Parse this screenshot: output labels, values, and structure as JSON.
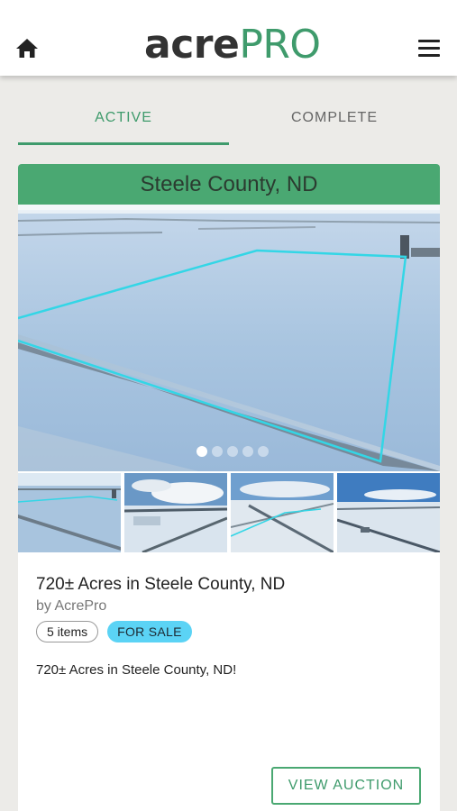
{
  "header": {
    "home_icon": "home-icon",
    "logo_part1": "acre",
    "logo_part2": "PRO",
    "menu_icon": "hamburger-menu-icon"
  },
  "tabs": [
    {
      "label": "ACTIVE",
      "selected": true
    },
    {
      "label": "COMPLETE",
      "selected": false
    }
  ],
  "listing": {
    "location_header": "Steele County, ND",
    "title": "720± Acres in Steele County, ND",
    "by": "by AcrePro",
    "items_badge": "5 items",
    "status_badge": "FOR SALE",
    "description": "720± Acres in Steele County, ND!",
    "button_label": "VIEW AUCTION",
    "carousel": {
      "slide_count": 5,
      "active_slide": 1
    },
    "thumbnail_count": 4
  },
  "colors": {
    "brand_green": "#3f9b6c",
    "header_green": "#4aa872",
    "sale_badge": "#5bd3f5",
    "boundary_line": "#33d6e6",
    "page_bg": "#ecebe8"
  }
}
